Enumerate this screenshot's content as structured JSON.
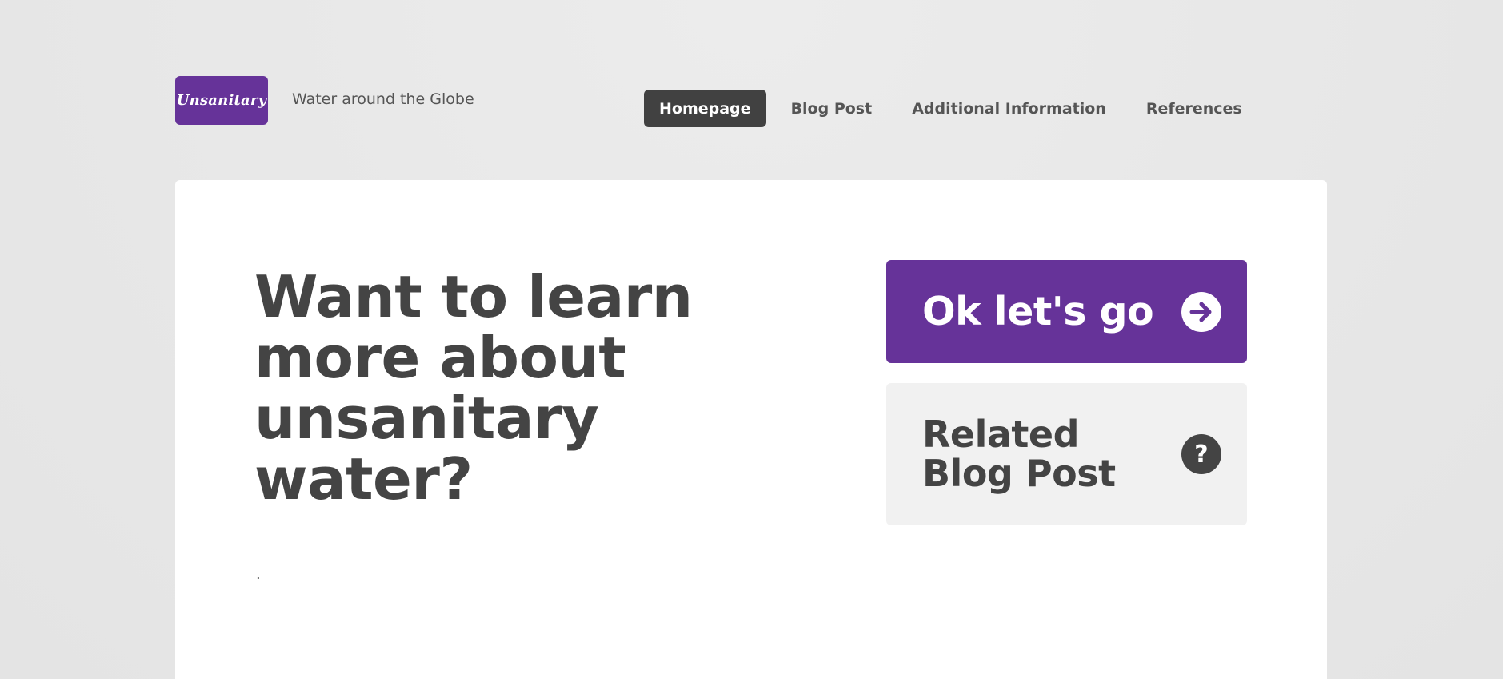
{
  "header": {
    "logo_text": "Unsanitary",
    "tagline": "Water around the Globe",
    "nav": [
      {
        "label": "Homepage",
        "active": true
      },
      {
        "label": "Blog Post",
        "active": false
      },
      {
        "label": "Additional Information",
        "active": false
      },
      {
        "label": "References",
        "active": false
      }
    ]
  },
  "main": {
    "headline": "Want to learn more about unsanitary water?",
    "note": ".",
    "primary_cta": {
      "label": "Ok let's go",
      "icon": "arrow-right-circle-icon"
    },
    "secondary_cta": {
      "label": "Related Blog Post",
      "icon": "question-circle-icon"
    }
  },
  "colors": {
    "brand_purple": "#663399",
    "nav_active_bg": "#414141",
    "text_dark": "#444444",
    "secondary_bg": "#f1f1f1"
  }
}
